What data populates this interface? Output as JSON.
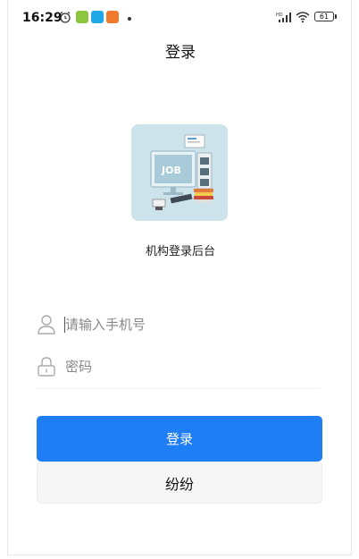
{
  "status_bar": {
    "time": "16:29",
    "battery": "61",
    "network": "HD",
    "notification_icons": [
      "alarm-icon",
      "green-app-icon",
      "blue-app-icon",
      "orange-app-icon"
    ]
  },
  "header": {
    "title": "登录"
  },
  "logo": {
    "label": "JOB"
  },
  "subtitle": "机构登录后台",
  "form": {
    "phone_placeholder": "请输入手机号",
    "password_placeholder": "密码"
  },
  "buttons": {
    "login": "登录",
    "secondary": "纷纷"
  },
  "colors": {
    "primary": "#1d7ef5",
    "secondary_bg": "#f6f6f6",
    "logo_bg": "#cde3ec"
  }
}
